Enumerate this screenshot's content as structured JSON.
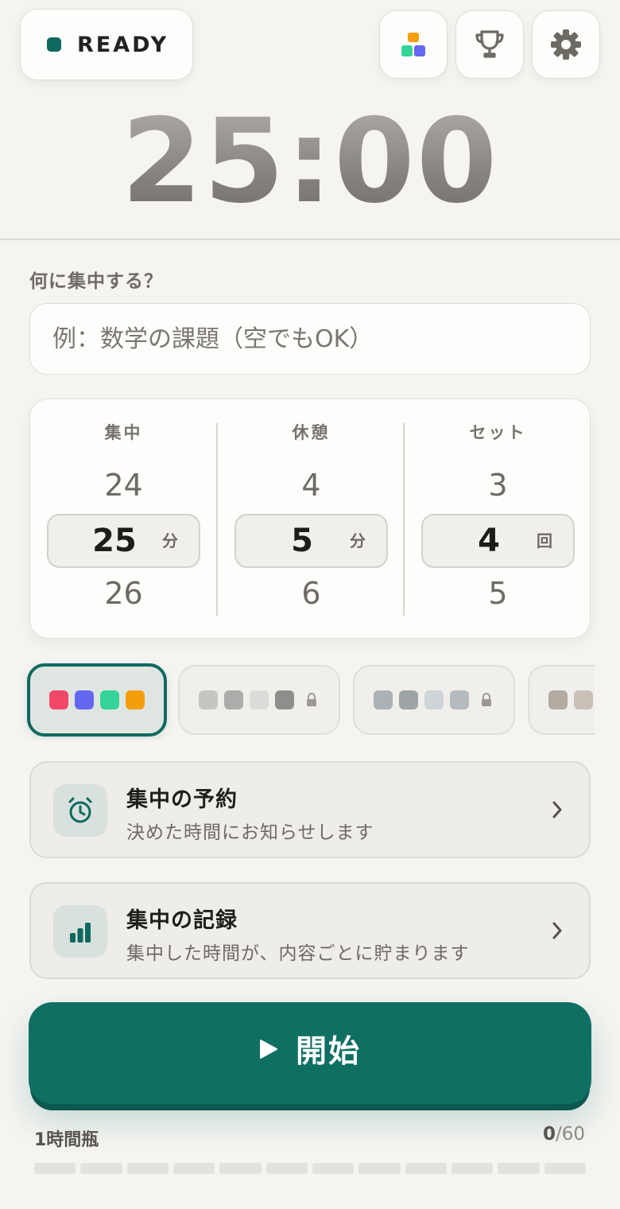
{
  "status": {
    "label": "READY",
    "dot_color": "#10695f"
  },
  "header_icons": [
    "themes-icon",
    "trophy-icon",
    "gear-icon"
  ],
  "timer": {
    "display": "25:00"
  },
  "focus": {
    "label": "何に集中する？",
    "placeholder": "例：数学の課題（空でもOK）",
    "value": ""
  },
  "picker": {
    "columns": [
      {
        "header": "集中",
        "prev": "24",
        "selected": "25",
        "next": "26",
        "unit": "分"
      },
      {
        "header": "休憩",
        "prev": "4",
        "selected": "5",
        "next": "6",
        "unit": "分"
      },
      {
        "header": "セット",
        "prev": "3",
        "selected": "4",
        "next": "5",
        "unit": "回"
      }
    ]
  },
  "themes": [
    {
      "colors": [
        "#f24767",
        "#6468f1",
        "#34d399",
        "#f59e0b"
      ],
      "locked": false,
      "selected": true
    },
    {
      "colors": [
        "#c3c6c1",
        "#abadaa",
        "#dadcd9",
        "#8e8e8c"
      ],
      "locked": true,
      "selected": false
    },
    {
      "colors": [
        "#abb1b5",
        "#9ea4a6",
        "#cfd4d8",
        "#b4babd"
      ],
      "locked": true,
      "selected": false
    },
    {
      "colors": [
        "#b3aaa2",
        "#c9c0b7"
      ],
      "locked": true,
      "selected": false
    }
  ],
  "rows": [
    {
      "title": "集中の予約",
      "subtitle": "決めた時間にお知らせします",
      "icon": "alarm-clock-icon"
    },
    {
      "title": "集中の記録",
      "subtitle": "集中した時間が、内容ごとに貯まります",
      "icon": "bar-chart-icon"
    }
  ],
  "start_button": {
    "label": "開始",
    "color": "#0f6f63"
  },
  "jar": {
    "label": "1時間瓶",
    "current": "0",
    "total": "/60",
    "segments": 12,
    "filled": 0
  }
}
